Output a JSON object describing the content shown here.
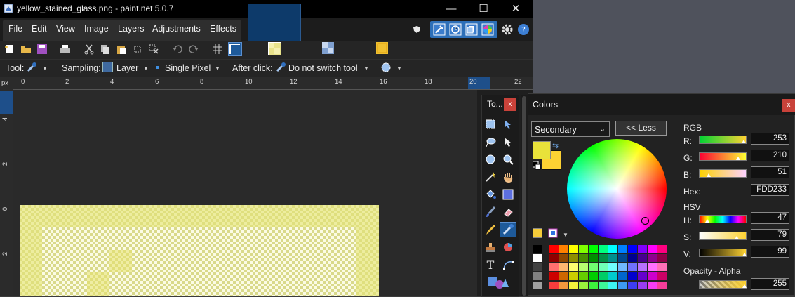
{
  "window": {
    "title": "yellow_stained_glass.png - paint.net 5.0.7",
    "min": "—",
    "max": "☐",
    "close": "✕"
  },
  "menu": [
    "File",
    "Edit",
    "View",
    "Image",
    "Layers",
    "Adjustments",
    "Effects"
  ],
  "toolbar": {
    "tool_label": "Tool:",
    "sampling_label": "Sampling:",
    "sampling_value": "Layer",
    "sample_mode": "Single Pixel",
    "after_click_label": "After click:",
    "after_click_value": "Do not switch tool"
  },
  "ruler": {
    "unit": "px",
    "h_ticks": [
      "0",
      "2",
      "4",
      "6",
      "8",
      "10",
      "12",
      "14",
      "16",
      "18",
      "20",
      "22"
    ],
    "v_ticks": [
      "4",
      "2",
      "0",
      "2"
    ]
  },
  "tools_window": {
    "title": "To...",
    "close": "x"
  },
  "colors_window": {
    "title": "Colors",
    "close": "x",
    "target": "Secondary",
    "less_button": "<< Less",
    "rgb_label": "RGB",
    "r_label": "R:",
    "g_label": "G:",
    "b_label": "B:",
    "r": "253",
    "g": "210",
    "b": "51",
    "hex_label": "Hex:",
    "hex": "FDD233",
    "hsv_label": "HSV",
    "h_label": "H:",
    "s_label": "S:",
    "v_label": "V:",
    "h": "47",
    "s": "79",
    "v": "99",
    "opacity_label": "Opacity - Alpha",
    "alpha": "255",
    "primary_color": "#e8e23a",
    "secondary_color": "#fdd233"
  }
}
